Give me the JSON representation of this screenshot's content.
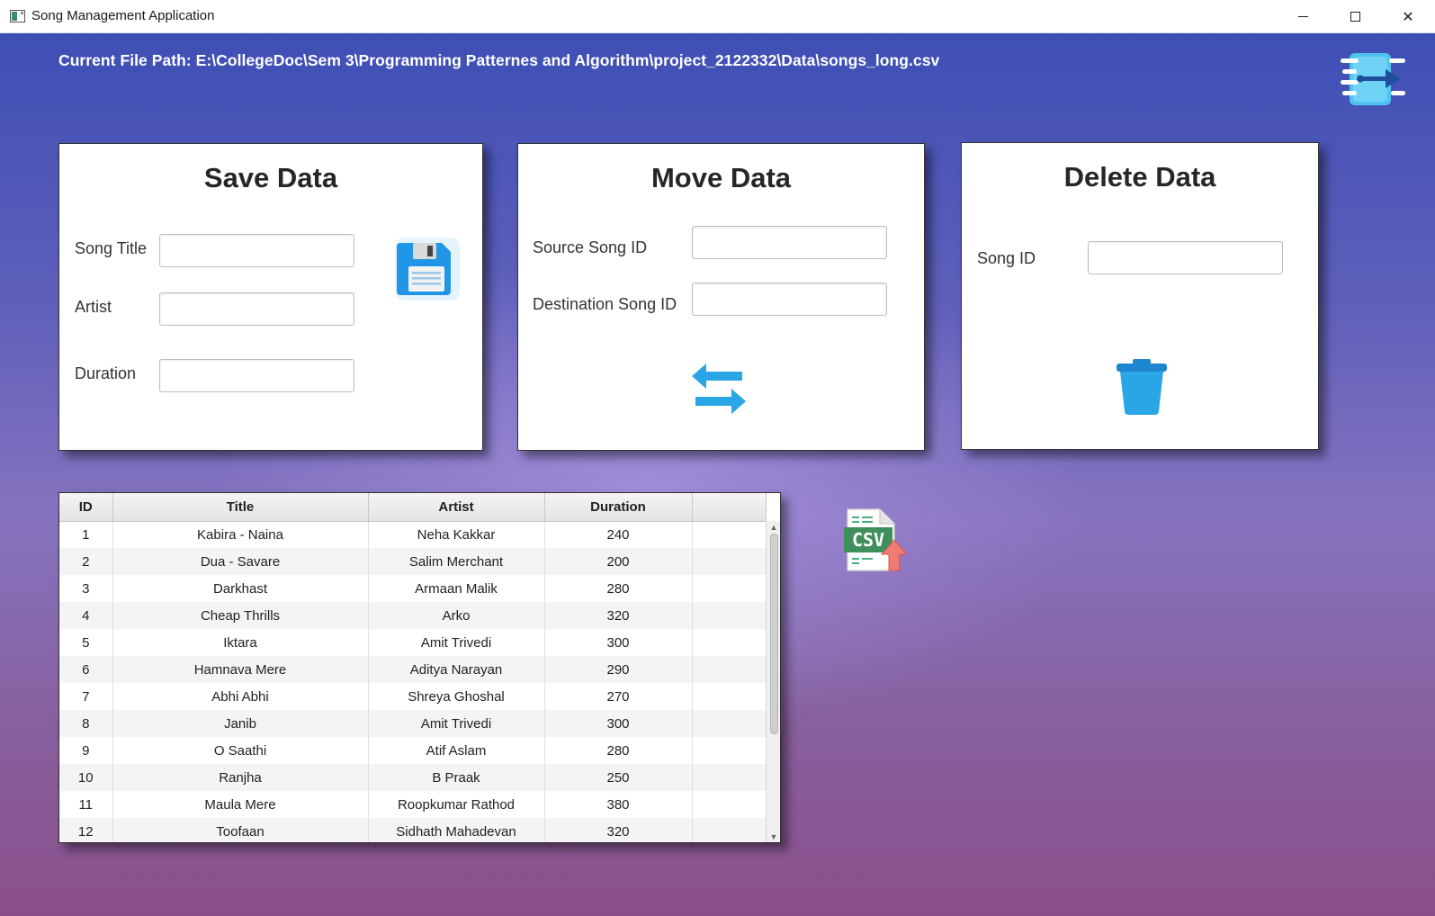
{
  "window": {
    "title": "Song Management Application"
  },
  "header": {
    "file_path": "Current File Path: E:\\CollegeDoc\\Sem 3\\Programming Patternes and Algorithm\\project_2122332\\Data\\songs_long.csv",
    "exit_icon": "exit-door-icon"
  },
  "save_panel": {
    "title": "Save Data",
    "song_title_label": "Song Title",
    "song_title_value": "",
    "artist_label": "Artist",
    "artist_value": "",
    "duration_label": "Duration",
    "duration_value": "",
    "icon": "floppy-disk-icon"
  },
  "move_panel": {
    "title": "Move Data",
    "source_label": "Source Song ID",
    "source_value": "",
    "destination_label": "Destination Song ID",
    "destination_value": "",
    "icon": "swap-arrows-icon"
  },
  "delete_panel": {
    "title": "Delete Data",
    "song_id_label": "Song ID",
    "song_id_value": "",
    "icon": "trash-icon"
  },
  "table": {
    "columns": [
      "ID",
      "Title",
      "Artist",
      "Duration"
    ],
    "rows": [
      {
        "id": "1",
        "title": "Kabira - Naina",
        "artist": "Neha Kakkar",
        "duration": "240"
      },
      {
        "id": "2",
        "title": "Dua - Savare",
        "artist": "Salim Merchant",
        "duration": "200"
      },
      {
        "id": "3",
        "title": "Darkhast",
        "artist": "Armaan Malik",
        "duration": "280"
      },
      {
        "id": "4",
        "title": "Cheap Thrills",
        "artist": "Arko",
        "duration": "320"
      },
      {
        "id": "5",
        "title": "Iktara",
        "artist": "Amit Trivedi",
        "duration": "300"
      },
      {
        "id": "6",
        "title": "Hamnava Mere",
        "artist": "Aditya Narayan",
        "duration": "290"
      },
      {
        "id": "7",
        "title": "Abhi Abhi",
        "artist": "Shreya Ghoshal",
        "duration": "270"
      },
      {
        "id": "8",
        "title": "Janib",
        "artist": "Amit Trivedi",
        "duration": "300"
      },
      {
        "id": "9",
        "title": "O Saathi",
        "artist": "Atif Aslam",
        "duration": "280"
      },
      {
        "id": "10",
        "title": "Ranjha",
        "artist": "B Praak",
        "duration": "250"
      },
      {
        "id": "11",
        "title": "Maula Mere",
        "artist": "Roopkumar Rathod",
        "duration": "380"
      },
      {
        "id": "12",
        "title": "Toofaan",
        "artist": "Sidhath Mahadevan",
        "duration": "320"
      }
    ]
  },
  "csv_import": {
    "icon": "csv-upload-icon",
    "badge_text": "CSV"
  },
  "colors": {
    "accent_blue": "#2aa5e6",
    "bg_top": "#3e4fb4",
    "bg_bottom": "#8a4f8b"
  }
}
